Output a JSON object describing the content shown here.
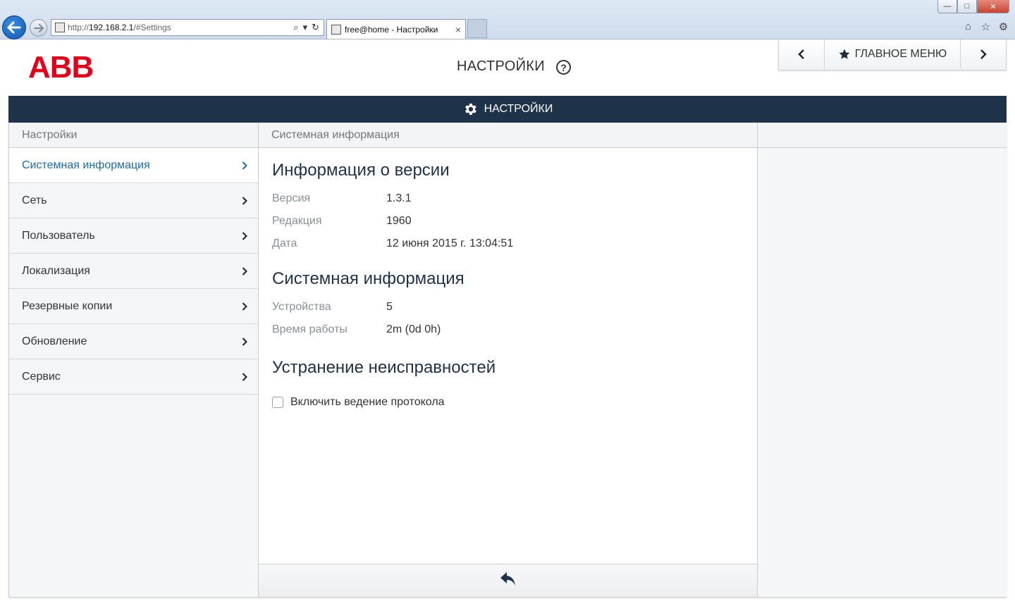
{
  "browser": {
    "url_proto": "http://",
    "url_host": "192.168.2.1",
    "url_path": "/#Settings",
    "tab_title": "free@home - Настройки",
    "tab_close": "×",
    "win_min": "—",
    "win_max": "□",
    "win_close": "✕"
  },
  "header": {
    "logo": "ABB",
    "title": "НАСТРОЙКИ",
    "help": "?",
    "main_menu_label": "ГЛАВНОЕ МЕНЮ"
  },
  "section_bar": {
    "title": "НАСТРОЙКИ"
  },
  "left_panel": {
    "heading": "Настройки",
    "items": [
      {
        "label": "Системная информация",
        "active": true
      },
      {
        "label": "Сеть"
      },
      {
        "label": "Пользователь"
      },
      {
        "label": "Локализация"
      },
      {
        "label": "Резервные копии"
      },
      {
        "label": "Обновление"
      },
      {
        "label": "Сервис"
      }
    ]
  },
  "mid_panel": {
    "heading": "Системная информация",
    "version_section": {
      "title": "Информация о версии",
      "rows": [
        {
          "key": "Версия",
          "value": "1.3.1"
        },
        {
          "key": "Редакция",
          "value": "1960"
        },
        {
          "key": "Дата",
          "value": "12 июня 2015 г. 13:04:51"
        }
      ]
    },
    "system_section": {
      "title": "Системная информация",
      "rows": [
        {
          "key": "Устройства",
          "value": "5"
        },
        {
          "key": "Время работы",
          "value": "2m (0d 0h)"
        }
      ]
    },
    "troubleshooting_section": {
      "title": "Устранение неисправностей",
      "checkbox_label": "Включить ведение протокола",
      "checkbox_checked": false
    }
  },
  "colors": {
    "brand_red": "#e2001a",
    "bar_dark": "#1e324a",
    "active_link": "#1a6db3"
  }
}
